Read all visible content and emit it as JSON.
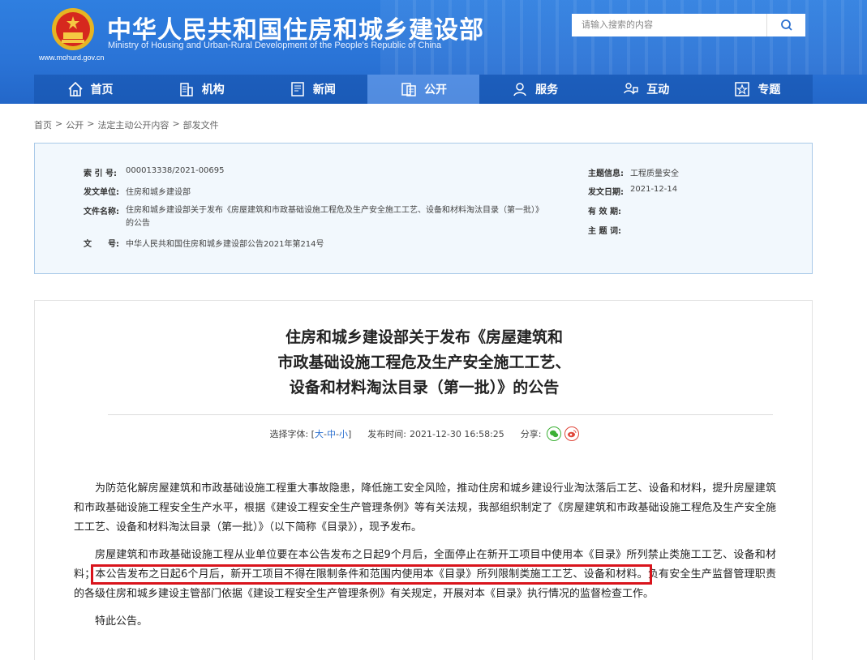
{
  "header": {
    "title": "中华人民共和国住房和城乡建设部",
    "subtitle": "Ministry of Housing and Urban-Rural Development of the People's Republic of China",
    "url": "www.mohurd.gov.cn",
    "search_placeholder": "请输入搜索的内容"
  },
  "nav": [
    {
      "label": "首页",
      "icon": "home-icon"
    },
    {
      "label": "机构",
      "icon": "building-icon"
    },
    {
      "label": "新闻",
      "icon": "news-icon"
    },
    {
      "label": "公开",
      "icon": "document-icon",
      "active": true
    },
    {
      "label": "服务",
      "icon": "service-icon"
    },
    {
      "label": "互动",
      "icon": "interact-icon"
    },
    {
      "label": "专题",
      "icon": "star-icon"
    }
  ],
  "breadcrumb": [
    "首页",
    "公开",
    "法定主动公开内容",
    "部发文件"
  ],
  "meta": {
    "index_label": "索 引 号:",
    "index_value": "000013338/2021-00695",
    "issuer_label": "发文单位:",
    "issuer_value": "住房和城乡建设部",
    "name_label": "文件名称:",
    "name_value_line1": "住房和城乡建设部关于发布《房屋建筑和市政基础设施工程危及生产安全施工工艺、设备和材料淘汰目录（第一批）》",
    "name_value_line2": "的公告",
    "docno_label": "文　　号:",
    "docno_value": "中华人民共和国住房和城乡建设部公告2021年第214号",
    "topic_label": "主题信息:",
    "topic_value": "工程质量安全",
    "date_label": "发文日期:",
    "date_value": "2021-12-14",
    "valid_label": "有 效 期:",
    "keyword_label": "主 题 词:"
  },
  "article": {
    "title_line1": "住房和城乡建设部关于发布《房屋建筑和",
    "title_line2": "市政基础设施工程危及生产安全施工工艺、",
    "title_line3": "设备和材料淘汰目录（第一批）》的公告",
    "font_label": "选择字体:",
    "font_large": "大",
    "font_medium": "中",
    "font_small": "小",
    "publish_label": "发布时间:",
    "publish_time": "2021-12-30 16:58:25",
    "share_label": "分享:",
    "para1": "为防范化解房屋建筑和市政基础设施工程重大事故隐患，降低施工安全风险，推动住房和城乡建设行业淘汰落后工艺、设备和材料，提升房屋建筑和市政基础设施工程安全生产水平，根据《建设工程安全生产管理条例》等有关法规，我部组织制定了《房屋建筑和市政基础设施工程危及生产安全施工工艺、设备和材料淘汰目录（第一批）》（以下简称《目录》），现予发布。",
    "para2_a": "房屋建筑和市政基础设施工程从业单位要在本公告发布之日起9个月后，全面停止在新开工项目中使用本《目录》所列禁止类施工工艺、设备和材料；",
    "para2_highlight": "本公告发布之日起6个月后，新开工项目不得在限制条件和范围内使用本《目录》所列限制类施工工艺、设备和材料。",
    "para2_b": "负有安全生产监督管理职责的各级住房和城乡建设主管部门依据《建设工程安全生产管理条例》有关规定，开展对本《目录》执行情况的监督检查工作。",
    "para3": "特此公告。"
  }
}
